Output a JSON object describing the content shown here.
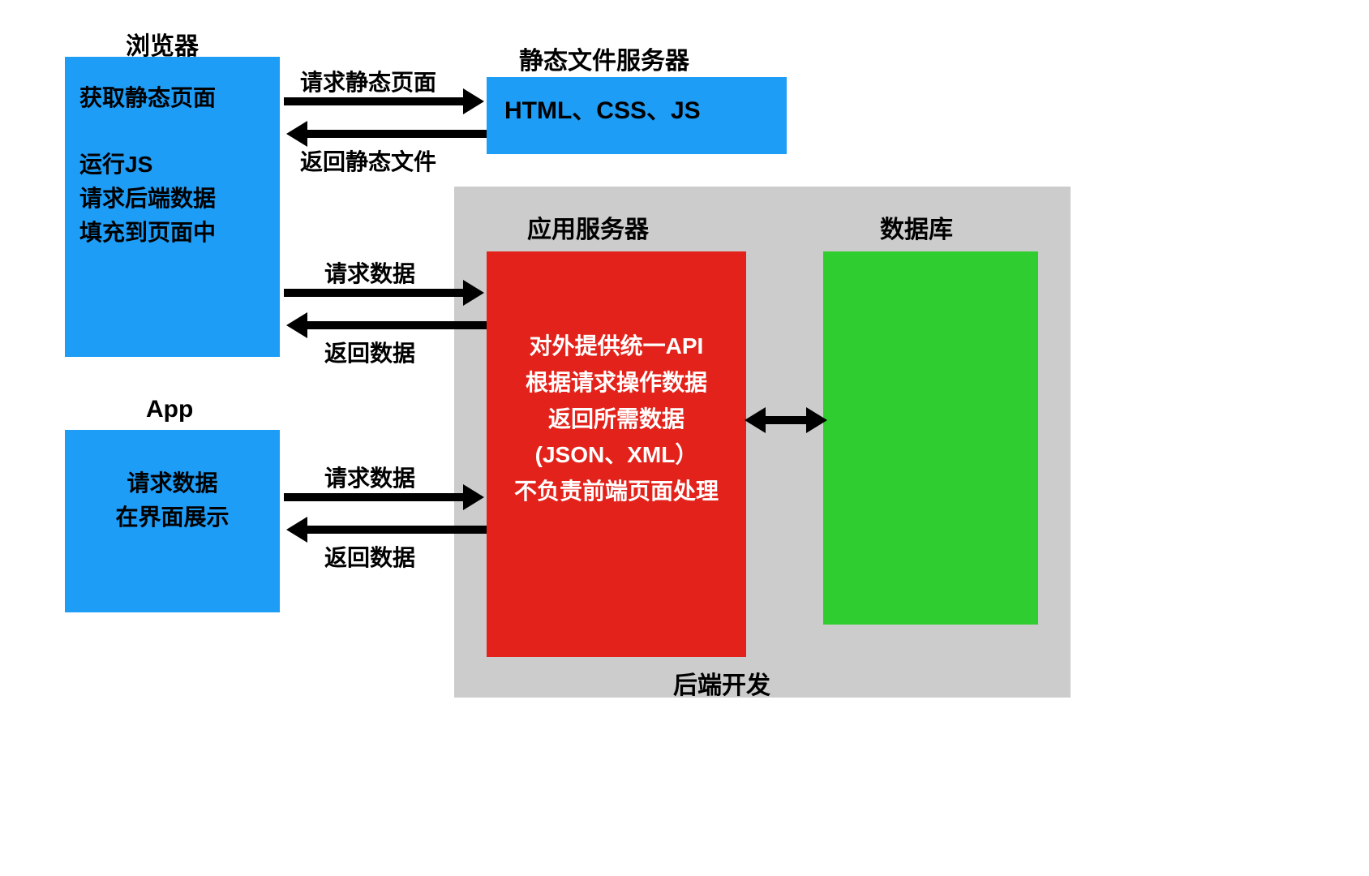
{
  "titles": {
    "browser": "浏览器",
    "static_server": "静态文件服务器",
    "app": "App",
    "application_server": "应用服务器",
    "database": "数据库",
    "backend_dev": "后端开发"
  },
  "boxes": {
    "browser": {
      "line1": "获取静态页面",
      "line2": "运行JS",
      "line3": "请求后端数据",
      "line4": "填充到页面中"
    },
    "static_server": {
      "text": "HTML、CSS、JS"
    },
    "app": {
      "line1": "请求数据",
      "line2": "在界面展示"
    },
    "app_server": {
      "line1": "对外提供统一API",
      "line2": "根据请求操作数据",
      "line3": "返回所需数据",
      "line4": "(JSON、XML）",
      "line5": "不负责前端页面处理"
    }
  },
  "arrows": {
    "static_req": "请求静态页面",
    "static_resp": "返回静态文件",
    "data_req1": "请求数据",
    "data_resp1": "返回数据",
    "data_req2": "请求数据",
    "data_resp2": "返回数据"
  },
  "colors": {
    "blue": "#1e9df7",
    "red": "#e3231b",
    "green": "#2fcd30",
    "grey": "#cccccc"
  }
}
